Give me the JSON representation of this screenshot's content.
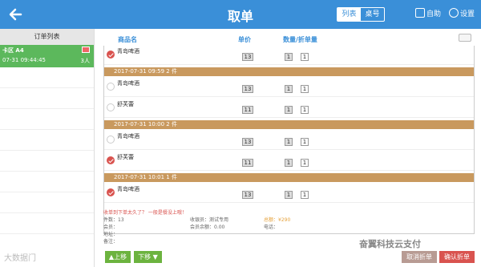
{
  "header": {
    "title": "取单",
    "view_list": "列表",
    "view_table": "桌号",
    "self_service": "自助",
    "settings": "设置"
  },
  "sidebar": {
    "heading": "订单列表",
    "selected": {
      "line1": "卡区 A4",
      "line2": "07-31 09:44:45",
      "count": "3人"
    }
  },
  "columns": {
    "name": "商品名",
    "price": "单价",
    "qty": "数量/折单量"
  },
  "items": [
    {
      "name": "青岛啤酒",
      "price": "13",
      "qty": "1",
      "split": "1",
      "checked": true
    },
    {
      "group": "2017-07-31 09:59  2 件"
    },
    {
      "name": "青岛啤酒",
      "price": "13",
      "qty": "1",
      "split": "1",
      "checked": false
    },
    {
      "name": "舒芙蕾",
      "price": "11",
      "qty": "1",
      "split": "1",
      "checked": false
    },
    {
      "group": "2017-07-31 10:00  2 件"
    },
    {
      "name": "青岛啤酒",
      "price": "13",
      "qty": "1",
      "split": "1",
      "checked": false
    },
    {
      "name": "舒芙蕾",
      "price": "11",
      "qty": "1",
      "split": "1",
      "checked": true
    },
    {
      "group": "2017-07-31 10:01  1 件"
    },
    {
      "name": "青岛啤酒",
      "price": "13",
      "qty": "1",
      "split": "1",
      "checked": true
    }
  ],
  "info": {
    "warning": "收单到下单太久了？ 一般是餐没上哦！",
    "count_label": "件数：13",
    "cashier_label": "收银员：测试专用",
    "total_label": "总额：¥290",
    "member_label": "会员：",
    "balance_label": "会员余额：0.00",
    "phone_label": "电话：",
    "address_label": "地址：",
    "note_label": "备注："
  },
  "buttons": {
    "up": "▲上移",
    "down": "下移 ▼",
    "cancel_split": "取消折单",
    "confirm_split": "确认折单"
  },
  "watermark": {
    "left": "大数据门",
    "right": "奋翼科技云支付"
  }
}
